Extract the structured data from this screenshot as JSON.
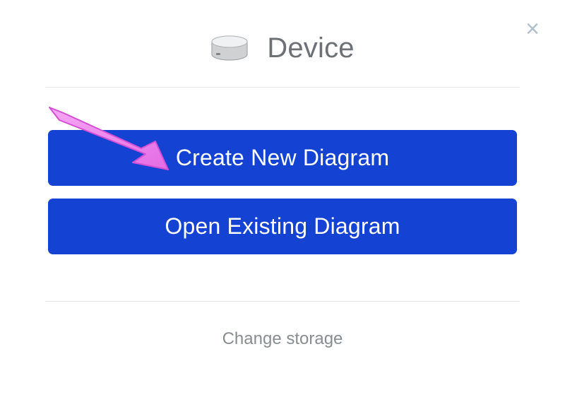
{
  "header": {
    "title": "Device",
    "icon_name": "drive-icon"
  },
  "buttons": {
    "create_label": "Create New Diagram",
    "open_label": "Open Existing Diagram"
  },
  "footer": {
    "change_storage_label": "Change storage"
  },
  "close": {
    "glyph": "×"
  },
  "colors": {
    "primary": "#1443d4",
    "muted_text": "#6d7175",
    "footer_text": "#888d91",
    "close_icon": "#b0c1cc",
    "divider": "#e5e7e8",
    "annotation": "#e878e8"
  }
}
